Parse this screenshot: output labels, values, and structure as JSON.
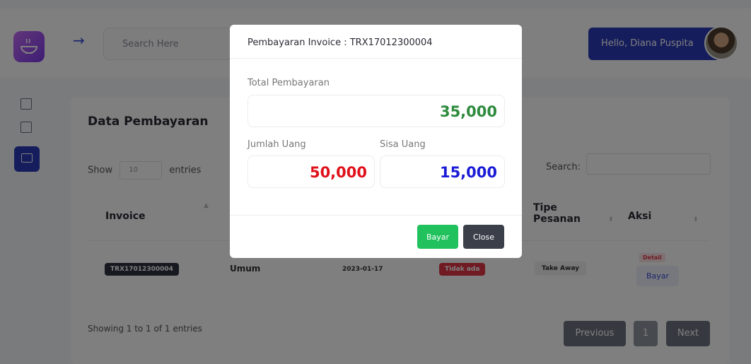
{
  "topbar": {
    "search_placeholder": "Search Here",
    "greeting": "Hello, Diana Puspita"
  },
  "card": {
    "title": "Data Pembayaran",
    "show_label": "Show",
    "entries_value": "10",
    "entries_label": "entries",
    "search_label": "Search:",
    "columns": [
      "Invoice",
      "Tipe Pesanan",
      "Aksi"
    ],
    "row": {
      "invoice": "TRX17012300004",
      "customer": "Umum",
      "date": "2023-01-17",
      "status": "Tidak ada",
      "order_type": "Take Away",
      "detail_label": "Detail",
      "bayar_label": "Bayar"
    },
    "showing": "Showing 1 to 1 of 1 entries",
    "pagination": {
      "previous": "Previous",
      "page": "1",
      "next": "Next"
    }
  },
  "modal": {
    "title": "Pembayaran Invoice : TRX17012300004",
    "total_label": "Total Pembayaran",
    "total_value": "35,000",
    "jumlah_label": "Jumlah Uang",
    "jumlah_value": "50,000",
    "sisa_label": "Sisa Uang",
    "sisa_value": "15,000",
    "bayar_button": "Bayar",
    "close_button": "Close"
  },
  "colors": {
    "primary": "#2a3ab9",
    "success": "#2e8b3d",
    "danger": "#e03547",
    "dark": "#2f3240"
  }
}
